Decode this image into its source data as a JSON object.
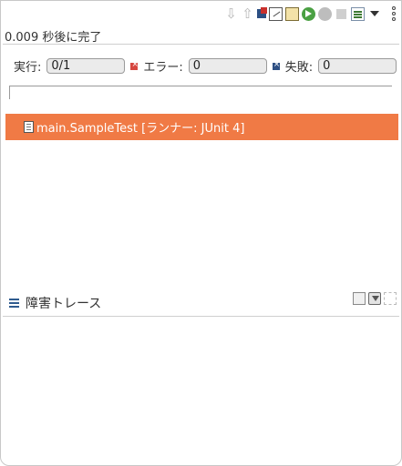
{
  "toolbar": {
    "icons": [
      "next-failure-icon",
      "previous-failure-icon",
      "show-failures-only-icon",
      "scroll-lock-icon",
      "history-icon",
      "rerun-test-icon",
      "rerun-failed-first-icon",
      "stop-icon",
      "layout-icon",
      "view-menu-icon",
      "more-options-icon"
    ]
  },
  "status": {
    "text": "0.009 秒後に完了"
  },
  "counters": {
    "runs_label": "実行:",
    "runs_value": "0/1",
    "errors_label": "エラー:",
    "errors_value": "0",
    "failures_label": "失敗:",
    "failures_value": "0"
  },
  "progress": {
    "value": 0
  },
  "tests": [
    {
      "label": "main.SampleTest [ランナー: JUnit 4]",
      "status_color": "#f07a45"
    }
  ],
  "trace": {
    "title": "障害トレース"
  },
  "colors": {
    "accent": "#f07a45",
    "failure": "#2d4f83",
    "error": "#d6463f"
  }
}
